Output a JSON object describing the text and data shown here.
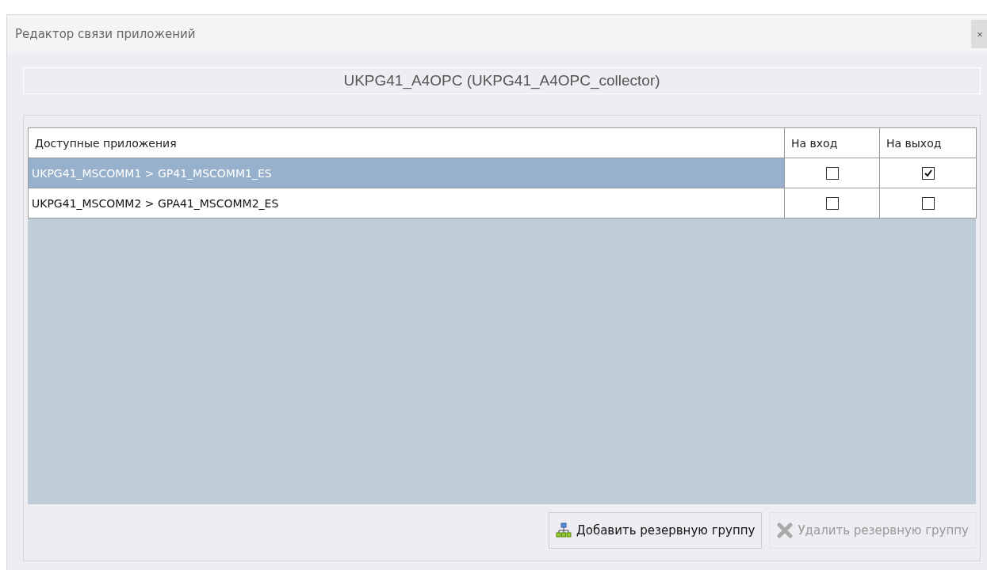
{
  "window": {
    "title": "Редактор связи приложений",
    "close": "×"
  },
  "header": "UKPG41_A4OPC (UKPG41_A4OPC_collector)",
  "table": {
    "columns": [
      "Доступные приложения",
      "На вход",
      "На выход"
    ],
    "rows": [
      {
        "name": "UKPG41_MSCOMM1 > GP41_MSCOMM1_ES",
        "input": false,
        "output": true,
        "selected": true
      },
      {
        "name": "UKPG41_MSCOMM2 > GPA41_MSCOMM2_ES",
        "input": false,
        "output": false,
        "selected": false
      }
    ]
  },
  "buttons": [
    {
      "label": "Добавить резервную группу",
      "kind": "add",
      "disabled": false
    },
    {
      "label": "Удалить резервную группу",
      "kind": "delete",
      "disabled": true
    }
  ]
}
